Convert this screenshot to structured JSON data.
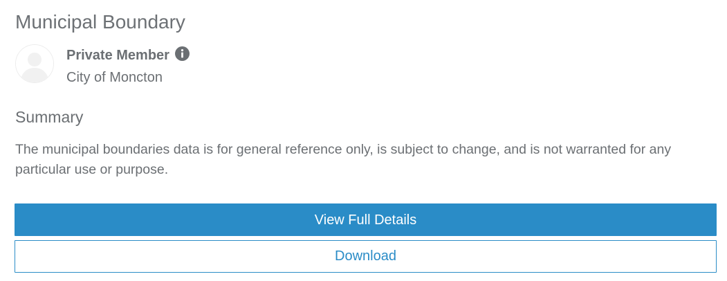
{
  "item": {
    "title": "Municipal Boundary",
    "owner": {
      "name": "Private Member",
      "organization": "City of Moncton",
      "avatar_icon": "default-user-silhouette",
      "info_icon": "info-circle"
    },
    "summary": {
      "heading": "Summary",
      "text": "The municipal boundaries data is for general reference only, is subject to change, and is not warranted for any particular use or purpose."
    },
    "actions": {
      "view_details_label": "View Full Details",
      "download_label": "Download"
    }
  },
  "colors": {
    "accent": "#2a8cc7",
    "text": "#6b6f73",
    "icon": "#6b6f73",
    "background": "#ffffff"
  }
}
